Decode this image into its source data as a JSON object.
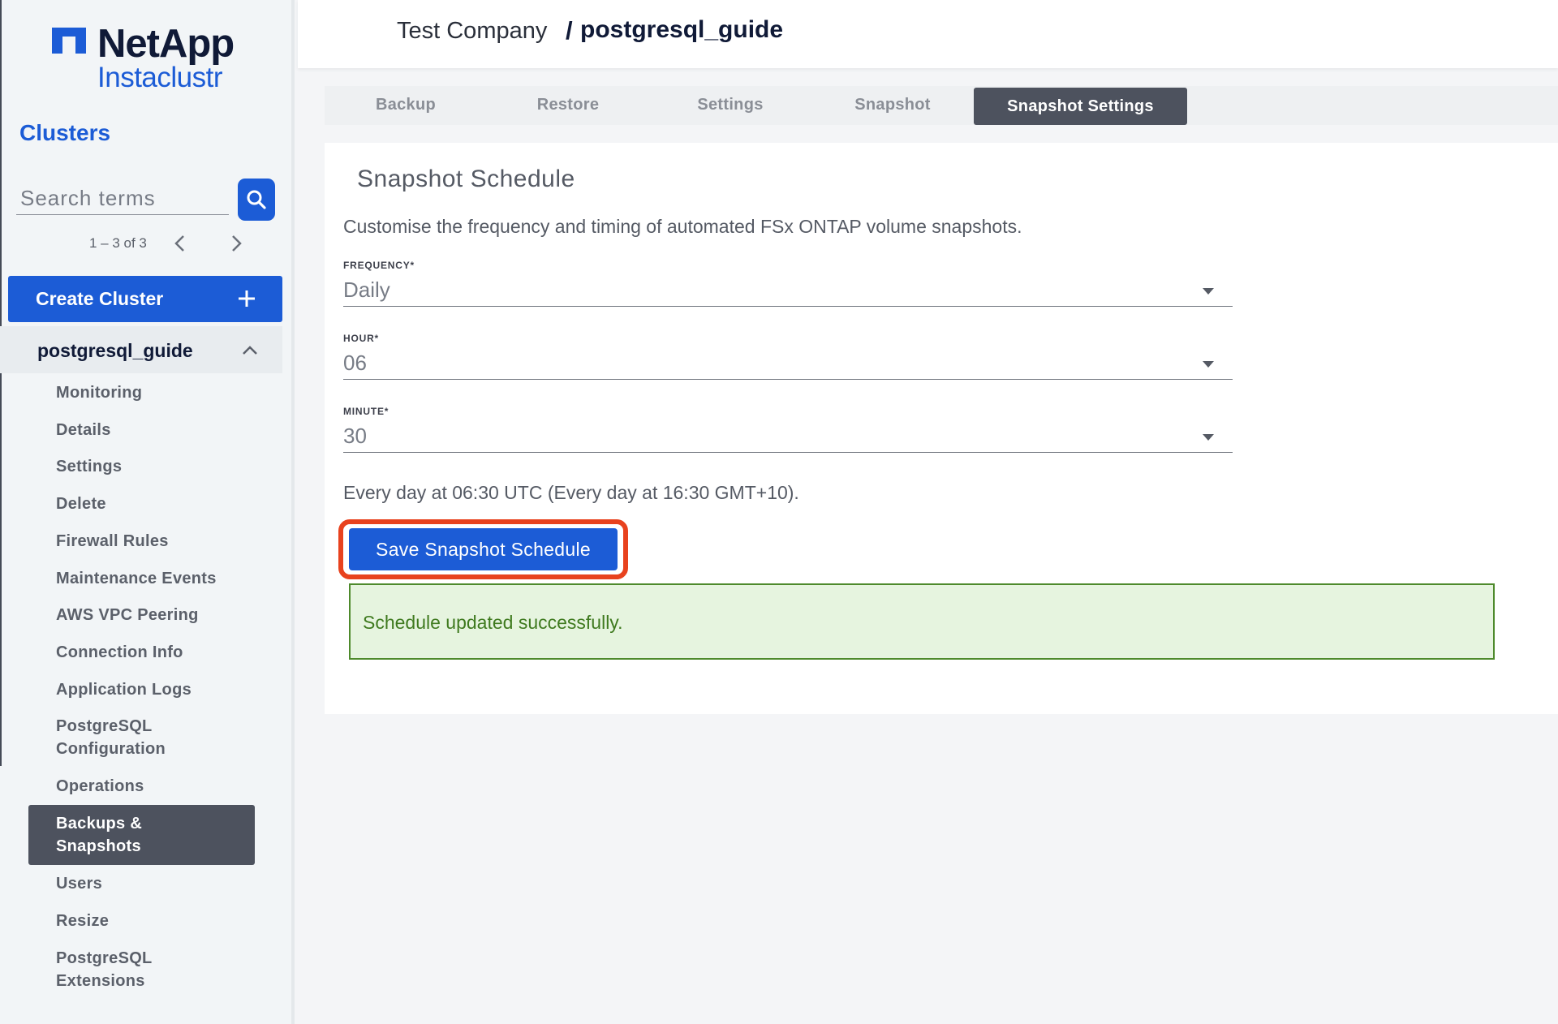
{
  "brand": {
    "name": "NetApp",
    "product": "Instaclustr"
  },
  "sidebar": {
    "section_title": "Clusters",
    "search": {
      "placeholder": "Search terms",
      "value": ""
    },
    "pagination": {
      "text": "1 – 3 of 3"
    },
    "create_button": "Create Cluster",
    "cluster_name": "postgresql_guide",
    "items": [
      {
        "label": "Monitoring"
      },
      {
        "label": "Details"
      },
      {
        "label": "Settings"
      },
      {
        "label": "Delete"
      },
      {
        "label": "Firewall Rules"
      },
      {
        "label": "Maintenance Events"
      },
      {
        "label": "AWS VPC Peering"
      },
      {
        "label": "Connection Info"
      },
      {
        "label": "Application Logs"
      },
      {
        "label_line1": "PostgreSQL",
        "label_line2": "Configuration"
      },
      {
        "label": "Operations"
      },
      {
        "label_line1": "Backups &",
        "label_line2": "Snapshots",
        "active": true
      },
      {
        "label": "Users"
      },
      {
        "label": "Resize"
      },
      {
        "label_line1": "PostgreSQL",
        "label_line2": "Extensions"
      }
    ]
  },
  "header": {
    "company": "Test Company",
    "separator": "/",
    "cluster": "postgresql_guide"
  },
  "tabs": [
    {
      "label": "Backup"
    },
    {
      "label": "Restore"
    },
    {
      "label": "Settings"
    },
    {
      "label": "Snapshot"
    },
    {
      "label": "Snapshot Settings",
      "active": true
    }
  ],
  "card": {
    "title": "Snapshot Schedule",
    "description": "Customise the frequency and timing of automated FSx ONTAP volume snapshots.",
    "fields": {
      "frequency": {
        "label": "FREQUENCY*",
        "value": "Daily"
      },
      "hour": {
        "label": "HOUR*",
        "value": "06"
      },
      "minute": {
        "label": "MINUTE*",
        "value": "30"
      }
    },
    "schedule_summary": "Every day at 06:30 UTC (Every day at 16:30 GMT+10).",
    "save_button": "Save Snapshot Schedule",
    "success_message": "Schedule updated successfully."
  },
  "colors": {
    "accent_blue": "#1c5cd6",
    "dark_navy": "#101a37",
    "active_gray": "#4d525e",
    "highlight_red": "#e8421e",
    "success_green": "#4e8a2c",
    "success_bg": "#e6f4df"
  },
  "icons": {
    "search": "search-icon",
    "prev": "chevron-left-icon",
    "next": "chevron-right-icon",
    "add": "plus-icon",
    "collapse": "chevron-up-icon",
    "dropdown": "caret-down-icon",
    "logo": "netapp-logo-icon"
  }
}
